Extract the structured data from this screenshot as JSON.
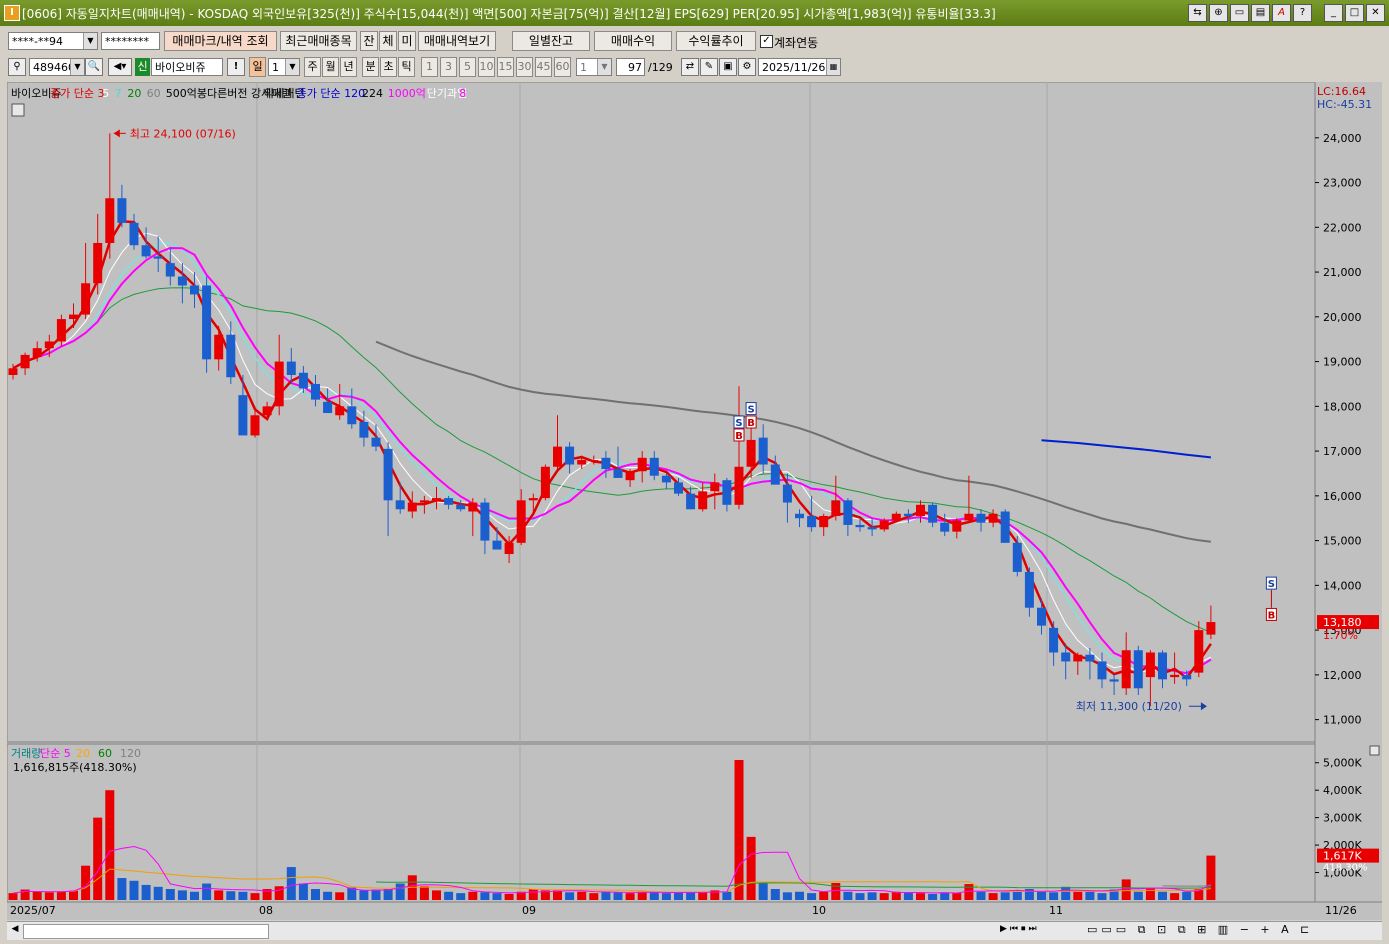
{
  "window": {
    "title": "[0606] 자동일지차트(매매내역) - KOSDAQ 외국인보유[325(천)] 주식수[15,044(천)] 액면[500] 자본금[75(억)] 결산[12월] EPS[629] PER[20.95] 시가총액[1,983(억)] 유통비율[33.3]",
    "app_icon": "I"
  },
  "toolbar": {
    "account": "****-**94",
    "password": "********",
    "btn_mark": "매매마크/내역 조회",
    "btn_recent": "최근매매종목",
    "btn_jan": "잔",
    "btn_che": "체",
    "btn_mi": "미",
    "btn_history": "매매내역보기",
    "btn_daily": "일별잔고",
    "btn_profit": "매매수익",
    "btn_rate": "수익률추이",
    "chk_mark": "✓",
    "chk_label": "계좌연동"
  },
  "toolbar2": {
    "code": "489460",
    "sin": "신",
    "stock_name": "바이오비쥬",
    "excl": "!",
    "period_day": "일",
    "period_num": "1",
    "periods": [
      "주",
      "월",
      "년",
      "분",
      "초",
      "틱"
    ],
    "intervals": [
      "1",
      "3",
      "5",
      "10",
      "15",
      "30",
      "45",
      "60"
    ],
    "num_select": "1",
    "count": "97",
    "count_total": "/129",
    "date": "2025/11/26"
  },
  "legend_price": [
    {
      "text": "바이오비쥬",
      "color": "#000000"
    },
    {
      "text": "종가 단순 3",
      "color": "#e00000"
    },
    {
      "text": "5",
      "color": "#ffffff"
    },
    {
      "text": "7",
      "color": "#40e0d0"
    },
    {
      "text": "20",
      "color": "#008000"
    },
    {
      "text": "60",
      "color": "#808080"
    },
    {
      "text": "500억봉다른버전 강세패턴",
      "color": "#000000"
    },
    {
      "text": "약세패턴",
      "color": "#000000"
    },
    {
      "text": "종가 단순 120",
      "color": "#0000d0"
    },
    {
      "text": "224",
      "color": "#000000"
    },
    {
      "text": "1000억",
      "color": "#ff00ff"
    },
    {
      "text": "단기과열",
      "color": "#ffffff"
    },
    {
      "text": "8",
      "color": "#ff00ff"
    }
  ],
  "lc_hc": {
    "lc": "LC:16.64",
    "hc": "HC:-45.31"
  },
  "price_axis": [
    "24,000",
    "23,000",
    "22,000",
    "21,000",
    "20,000",
    "19,000",
    "18,000",
    "17,000",
    "16,000",
    "15,000",
    "14,000",
    "13,000",
    "12,000",
    "11,000"
  ],
  "current_price": {
    "value": "13,180",
    "pct": "1.70%"
  },
  "annotations": {
    "high": "최고 24,100 (07/16)",
    "low": "최저 11,300 (11/20)"
  },
  "legend_volume": [
    {
      "text": "거래량",
      "color": "#008080"
    },
    {
      "text": "단순 5",
      "color": "#ff00ff"
    },
    {
      "text": "20",
      "color": "#ffa500"
    },
    {
      "text": "60",
      "color": "#008000"
    },
    {
      "text": "120",
      "color": "#808080"
    }
  ],
  "volume_info": "1,616,815주(418.30%)",
  "volume_axis": [
    "5,000K",
    "4,000K",
    "3,000K",
    "2,000K",
    "1,000K"
  ],
  "current_volume": {
    "value": "1,617K",
    "pct": "418.30%"
  },
  "date_axis": [
    "2025/07",
    "08",
    "09",
    "10",
    "11",
    "11/26"
  ],
  "trade_marks": [
    "S",
    "B"
  ],
  "colors": {
    "up": "#e80000",
    "down": "#1b5fcf",
    "ma3": "#e00000",
    "ma5": "#ffffff",
    "ma7": "#7fe0e0",
    "ma20": "#1f9a3a",
    "ma60": "#707070",
    "ma120": "#0020d0",
    "ma1000": "#ff00ff"
  },
  "chart_data": {
    "type": "candlestick",
    "ylim": [
      10500,
      24800
    ],
    "candles": [
      [
        18700,
        18950,
        18600,
        18850
      ],
      [
        18850,
        19200,
        18700,
        19150
      ],
      [
        19100,
        19450,
        19000,
        19300
      ],
      [
        19300,
        19600,
        19100,
        19450
      ],
      [
        19450,
        20050,
        19350,
        19950
      ],
      [
        19950,
        20300,
        19750,
        20050
      ],
      [
        20050,
        21650,
        19950,
        20750
      ],
      [
        20750,
        22300,
        20500,
        21650
      ],
      [
        21650,
        24100,
        21300,
        22650
      ],
      [
        22650,
        22950,
        22000,
        22100
      ],
      [
        22100,
        22300,
        21500,
        21600
      ],
      [
        21600,
        22000,
        21300,
        21350
      ],
      [
        21350,
        21800,
        21000,
        21300
      ],
      [
        21200,
        21550,
        20700,
        20900
      ],
      [
        20900,
        21200,
        20300,
        20700
      ],
      [
        20700,
        21000,
        20200,
        20500
      ],
      [
        20700,
        20900,
        18750,
        19050
      ],
      [
        19050,
        19800,
        18800,
        19600
      ],
      [
        19600,
        19900,
        18500,
        18650
      ],
      [
        18250,
        18700,
        17800,
        17350
      ],
      [
        17350,
        18000,
        17300,
        17800
      ],
      [
        17800,
        18100,
        17700,
        18000
      ],
      [
        18000,
        19600,
        17800,
        19000
      ],
      [
        19000,
        19300,
        18500,
        18700
      ],
      [
        18750,
        18900,
        18300,
        18400
      ],
      [
        18500,
        18700,
        18000,
        18150
      ],
      [
        18100,
        18400,
        17900,
        17850
      ],
      [
        17800,
        18500,
        17700,
        18000
      ],
      [
        18000,
        18400,
        17500,
        17600
      ],
      [
        17650,
        17900,
        17100,
        17300
      ],
      [
        17300,
        17600,
        17000,
        17100
      ],
      [
        17050,
        17200,
        15100,
        15900
      ],
      [
        15900,
        16300,
        15600,
        15700
      ],
      [
        15650,
        16100,
        15500,
        15850
      ],
      [
        15850,
        16000,
        15600,
        15900
      ],
      [
        15900,
        16200,
        15700,
        15950
      ],
      [
        15950,
        16000,
        15700,
        15800
      ],
      [
        15800,
        15900,
        15650,
        15700
      ],
      [
        15650,
        15950,
        15100,
        15850
      ],
      [
        15850,
        15950,
        14700,
        15000
      ],
      [
        15000,
        15300,
        14800,
        14800
      ],
      [
        14700,
        15100,
        14500,
        14950
      ],
      [
        14950,
        16150,
        14900,
        15900
      ],
      [
        15900,
        16050,
        15650,
        15950
      ],
      [
        15950,
        16700,
        15900,
        16650
      ],
      [
        16650,
        17800,
        16600,
        17100
      ],
      [
        17100,
        17200,
        16500,
        16700
      ],
      [
        16700,
        16900,
        16600,
        16800
      ],
      [
        16800,
        16900,
        16700,
        16800
      ],
      [
        16850,
        17000,
        16400,
        16600
      ],
      [
        16600,
        17100,
        16500,
        16400
      ],
      [
        16350,
        16600,
        16200,
        16550
      ],
      [
        16550,
        17000,
        16300,
        16850
      ],
      [
        16850,
        17000,
        16350,
        16450
      ],
      [
        16450,
        16500,
        16150,
        16300
      ],
      [
        16300,
        16400,
        16000,
        16050
      ],
      [
        16050,
        16200,
        15700,
        15700
      ],
      [
        15700,
        16300,
        15650,
        16100
      ],
      [
        16100,
        16500,
        15700,
        16300
      ],
      [
        16350,
        16400,
        15650,
        15800
      ],
      [
        15800,
        18450,
        15700,
        16650
      ],
      [
        16650,
        17600,
        16400,
        17250
      ],
      [
        17300,
        17600,
        16500,
        16700
      ],
      [
        16700,
        16900,
        16300,
        16250
      ],
      [
        16250,
        16500,
        15400,
        15850
      ],
      [
        15600,
        15700,
        15300,
        15500
      ],
      [
        15550,
        16000,
        15200,
        15300
      ],
      [
        15300,
        15600,
        15100,
        15550
      ],
      [
        15550,
        16450,
        15450,
        15900
      ],
      [
        15900,
        15950,
        15100,
        15350
      ],
      [
        15350,
        15500,
        15200,
        15300
      ],
      [
        15300,
        15500,
        15100,
        15250
      ],
      [
        15250,
        15500,
        15200,
        15450
      ],
      [
        15450,
        15650,
        15400,
        15600
      ],
      [
        15600,
        15700,
        15400,
        15550
      ],
      [
        15550,
        15900,
        15400,
        15800
      ],
      [
        15800,
        15850,
        15300,
        15400
      ],
      [
        15400,
        15600,
        15100,
        15200
      ],
      [
        15200,
        15500,
        15050,
        15450
      ],
      [
        15450,
        16450,
        15400,
        15600
      ],
      [
        15600,
        15700,
        15200,
        15400
      ],
      [
        15400,
        15700,
        15300,
        15600
      ],
      [
        15650,
        15700,
        15000,
        14950
      ],
      [
        14950,
        15100,
        14200,
        14300
      ],
      [
        14300,
        14400,
        13300,
        13500
      ],
      [
        13500,
        13700,
        12900,
        13100
      ],
      [
        13050,
        13200,
        12200,
        12500
      ],
      [
        12500,
        12700,
        11900,
        12300
      ],
      [
        12300,
        12500,
        12000,
        12450
      ],
      [
        12450,
        12600,
        11900,
        12300
      ],
      [
        12300,
        12500,
        11700,
        11900
      ],
      [
        11900,
        12000,
        11550,
        11850
      ],
      [
        11700,
        12950,
        11550,
        12550
      ],
      [
        12550,
        12650,
        11550,
        11700
      ],
      [
        11950,
        12550,
        11300,
        12500
      ],
      [
        12500,
        12550,
        11700,
        11900
      ],
      [
        11950,
        12500,
        11800,
        12000
      ],
      [
        12000,
        12100,
        11750,
        11900
      ],
      [
        12050,
        13200,
        11950,
        13000
      ],
      [
        12900,
        13550,
        12800,
        13180
      ]
    ],
    "volumes": [
      250,
      380,
      300,
      280,
      320,
      340,
      1250,
      3000,
      4000,
      800,
      700,
      550,
      480,
      400,
      350,
      300,
      600,
      350,
      320,
      300,
      250,
      400,
      500,
      1200,
      600,
      400,
      300,
      280,
      450,
      350,
      380,
      400,
      600,
      900,
      500,
      350,
      300,
      250,
      300,
      280,
      250,
      220,
      300,
      400,
      350,
      350,
      280,
      300,
      250,
      300,
      280,
      250,
      300,
      280,
      250,
      280,
      280,
      300,
      350,
      300,
      5100,
      2300,
      600,
      400,
      280,
      300,
      250,
      300,
      620,
      300,
      250,
      280,
      250,
      300,
      280,
      250,
      220,
      280,
      250,
      580,
      300,
      250,
      280,
      350,
      400,
      300,
      280,
      480,
      300,
      350,
      250,
      380,
      750,
      300,
      450,
      300,
      250,
      300,
      400,
      1617
    ],
    "volume_ylim": [
      0,
      5100
    ],
    "ma120": [
      [
        85,
        17240
      ],
      [
        88,
        17180
      ],
      [
        91,
        17100
      ],
      [
        94,
        17020
      ],
      [
        97,
        16920
      ],
      [
        99,
        16860
      ]
    ]
  }
}
